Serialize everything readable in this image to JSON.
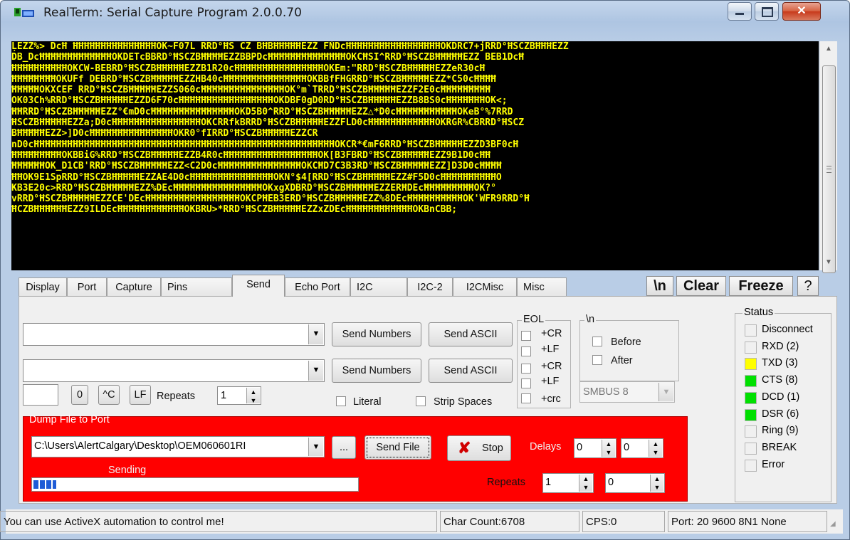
{
  "window": {
    "title": "RealTerm: Serial Capture Program 2.0.0.70",
    "close_glyph": "✕"
  },
  "terminal": {
    "lines": [
      "ĻEZŹ%> DcĦ ĦĦĦĦĦĦĦĦĦĦĦĦĦĦĦOK~F07L RRD°ĦŚ ĊZ BĦBĦĦĦĦĦEZŹ FŇDcĦĦĦĦĦĦĦĦĦĦĦĦĦĦĦĦĦOKDRC7+jRRD°ĦŚĊZBĦĦĦEZŹ",
      "DB_DcĦĦĦĦĦĦĦĦĦĦĦĦĦOKDETcBBRD°ĦŚĊZBĦĦĦĦEZŹBBPDcĦĦĦĦĦĦĦĦĦĦĦĦĦĦOKCĦSĪ^RRD°ĦŚĊZBĦĦĦĦĦEZŹ BEB1DcĦ",
      "ĦĦĦĦĦĦĦĦĦĦOKCW-BEBRD°ĦŚĊZBĦĦĦĦĦEZŹB1R20cĦĦĦĦĦĦĦĦĦĦĦĦĦĦĦĦOKEm:\"RRD°ĦŚĊZBĦĦĦĦĦEZŹeR30cĦ",
      "ĦĦĦĦĦĦĦĦOKUFf DEBRD°ĦŚĊZBĦĦĦĦĦEZŹHB40cĦĦĦĦĦĦĦĦĦĦĦĦĦĦĦOKBBfFHGRRD°ĦŚĊZBĦĦĦĦĦEZŹ*C50cĦĦĦĦ",
      "ĦĦĦĦĦOKXCEF RRD°ĦŚĊZBĦĦĦĦĦEZŹS060cĦĦĦĦĦĦĦĦĦĦĦĦĦĦĦOK°m`TRRD°ĦŚĊZBĦĦĦĦĦEZŹF2E0cĦĦĦĦĦĦĦĦĦ",
      "OK03Ch%RRD°ĦŚĊZBĦĦĦĦĦEZŹD6F70cĦĦĦĦĦĦĦĦĦĦĦĦĦĦĦĦĦOKDBF0gD0RD°ĦŚĊZBĦĦĦĦĦEZŹB8BS0cĦĦĦĦĦĦĦOK<;",
      "ĦĦRRD°ĦŚĊZBĦĦĦĦĦEZŹ°€mD0cĦĦĦĦĦĦĦĦĦĦĦĦĦĦĦOKD5B0^RRD°ĦŚĊZBĦĦĦĦĦEZŹ△*D0cĦĦĦĦĦĦĦĦĦĦĦOKeB°%7RRD",
      "ĦŚĊZBĦĦĦĦĦEZŹa;D0cĦĦĦĦĦĦĦĦĦĦĦĦĦĦĦĦOKCRRfkBRRD°ĦŚĊZBĦĦĦĦĦEZŹFLD0cĦĦĦĦĦĦĦĦĦĦĦĦOKRGR%CBRRD°ĦŚĊZ",
      "BĦĦĦĦĦEZŹ>]D0cĦĦĦĦĦĦĦĦĦĦĦĦĦĦĦOKR0°fIRRD°ĦŚĊZBĦĦĦĦĦEZŹCR",
      "nD0cĦĦĦĦĦĦĦĦĦĦĦĦĦĦĦĦĦĦĦĦĦĦĦĦĦĦĦĦĦĦĦĦĦĦĦĦĦĦĦĦĦĦĦĦĦĦĦĦĦĦĦĦĦĦOKCR*€mF6RRD°ĦŚĊZBĦĦĦĦĦEZŹD3BF0cĦ",
      "ĦĦĦĦĦĦĦĦĦOKBBiG%RRD°ĦŚĊZBĦĦĦĦĦEZŹB4R0cĦĦĦĦĦĦĦĦĦĦĦĦĦĦĦĦĦOK[B3FBRD°ĦŚĊZBĦĦĦĦĦEZŹ9B1D0cĦĦ",
      "ĦĦĦĦĦĦOK_D1CB'RRD°ĦŚĊZBĦĦĦĦĦEZŹ<C2D0cĦĦĦĦĦĦĦĦĦĦĦĦĦĦĦOKCĦD7C3B3RD°ĦŚĊZBĦĦĦĦĦEZŹ]D3D0cĦĦĦĦ",
      "ĦĦOK9E1SpRRD°ĦŚĊZBĦĦĦĦĦEZŹAE4D0cĦĦĦĦĦĦĦĦĦĦĦĦĦĦĦOKN°$4[RRD°ĦŚĊZBĦĦĦĦĦEZŹ#F5D0cĦĦĦĦĦĦĦĦĦĦO",
      "KB3E20c>RRD°ĦŚĊZBĦĦĦĦĦEZŹ%DEcĦĦĦĦĦĦĦĦĦĦĦĦĦĦĦĦOKxgXDBRD°ĦŚĊZBĦĦĦĦĦEZŹERĦDEcĦĦĦĦĦĦĦĦĦOK?°",
      "vRRD°ĦŚĊZBĦĦĦĦĦEZŹCE'DEcĦĦĦĦĦĦĦĦĦĦĦĦĦĦĦĦĦOKCPĦEB3ERD°ĦŚĊZBĦĦĦĦĦEZŹ%8DEcĦĦĦĦĦĦĦĦĦĦOK'WFR9RRD°Ħ",
      "ĦĊZBĦĦĦĦĦĦEZŹ9ILDEcĦĦĦĦĦĦĦĦĦĦĦĦOKBRU>*RRD°ĦŚĊZBĦĦĦĦĦEZŹxZDEcĦĦĦĦĦĦĦĦĦĦĦĦOKBnCBB;"
    ]
  },
  "tabs": [
    "Display",
    "Port",
    "Capture",
    "Pins",
    "Send",
    "Echo Port",
    "I2C",
    "I2C-2",
    "I2CMisc",
    "Misc"
  ],
  "active_tab": "Send",
  "top_buttons": {
    "newline": "\\n",
    "clear": "Clear",
    "freeze": "Freeze",
    "help": "?"
  },
  "send": {
    "row1": {
      "value": "",
      "send_numbers": "Send Numbers",
      "send_ascii": "Send ASCII"
    },
    "row2": {
      "value": "",
      "send_numbers": "Send Numbers",
      "send_ascii": "Send ASCII"
    },
    "small_input": "",
    "zero_btn": "0",
    "ctrl_c_btn": "^C",
    "lf_btn": "LF",
    "repeats_label": "Repeats",
    "repeats_value": "1",
    "literal": "Literal",
    "strip_spaces": "Strip Spaces"
  },
  "eol": {
    "title": "EOL",
    "items": [
      "+CR",
      "+LF",
      "+CR",
      "+LF",
      "+crc"
    ]
  },
  "nl_group": {
    "title": "\\n",
    "before": "Before",
    "after": "After"
  },
  "smbus": "SMBUS 8",
  "dump": {
    "title": "Dump File to Port",
    "file_path": "C:\\Users\\AlertCalgary\\Desktop\\OEM060601RI",
    "browse": "...",
    "send_file": "Send File",
    "stop": "Stop",
    "delays_label": "Delays",
    "delay1": "0",
    "delay2": "0",
    "sending_label": "Sending",
    "repeats_label": "Repeats",
    "repeats1": "1",
    "repeats2": "0",
    "progress_fraction": 0.07
  },
  "status": {
    "title": "Status",
    "items": [
      {
        "label": "Disconnect",
        "color": "#f0f0f0"
      },
      {
        "label": "RXD (2)",
        "color": "#f0f0f0"
      },
      {
        "label": "TXD (3)",
        "color": "#ffff00"
      },
      {
        "label": "CTS (8)",
        "color": "#00e000"
      },
      {
        "label": "DCD (1)",
        "color": "#00e000"
      },
      {
        "label": "DSR (6)",
        "color": "#00e000"
      },
      {
        "label": "Ring (9)",
        "color": "#f0f0f0"
      },
      {
        "label": "BREAK",
        "color": "#f0f0f0"
      },
      {
        "label": "Error",
        "color": "#f0f0f0"
      }
    ]
  },
  "statusbar": {
    "message": "You can use ActiveX automation to control me!",
    "char_count": "Char Count:6708",
    "cps": "CPS:0",
    "port": "Port: 20 9600 8N1 None"
  },
  "colors": {
    "terminal_bg": "#000000",
    "terminal_fg": "#ffff00",
    "dump_bg": "#ff0000",
    "progress": "#1e5bd6"
  }
}
